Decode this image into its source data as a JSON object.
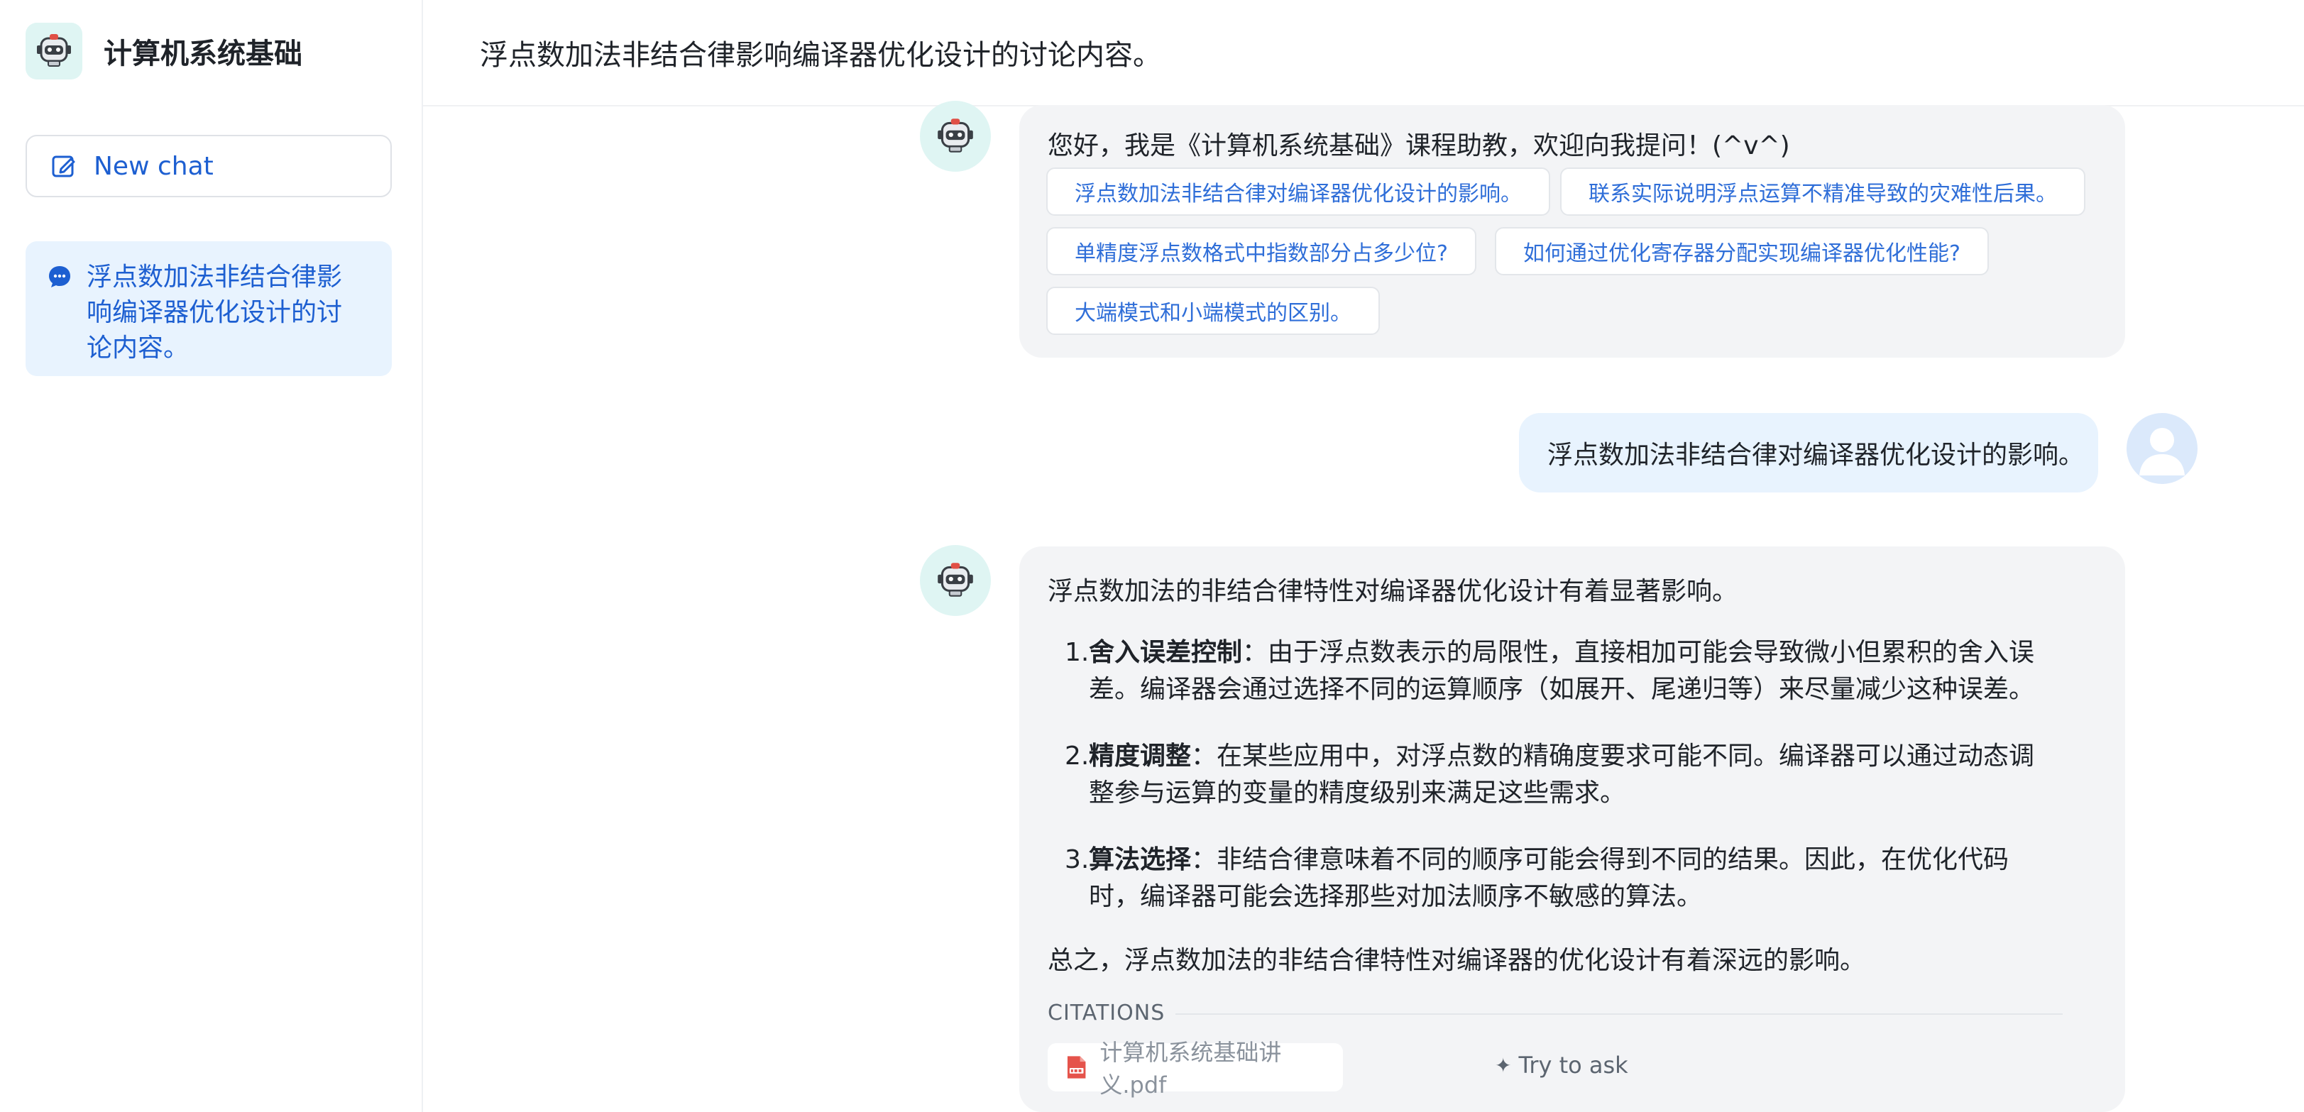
{
  "sidebar": {
    "app_title": "计算机系统基础",
    "new_chat_label": "New chat",
    "conversations": [
      {
        "label": "浮点数加法非结合律影响编译器优化设计的讨论内容。"
      }
    ]
  },
  "header": {
    "title": "浮点数加法非结合律影响编译器优化设计的讨论内容。"
  },
  "chat": {
    "greeting": {
      "text": "您好，我是《计算机系统基础》课程助教，欢迎向我提问！(^v^)",
      "suggestions": [
        "浮点数加法非结合律对编译器优化设计的影响。",
        "联系实际说明浮点运算不精准导致的灾难性后果。",
        "单精度浮点数格式中指数部分占多少位?",
        "如何通过优化寄存器分配实现编译器优化性能?",
        "大端模式和小端模式的区别。"
      ]
    },
    "user_message": "浮点数加法非结合律对编译器优化设计的影响。",
    "answer": {
      "intro": "浮点数加法的非结合律特性对编译器优化设计有着显著影响。",
      "items": [
        {
          "num": "1.",
          "title": "舍入误差控制",
          "text": "：由于浮点数表示的局限性，直接相加可能会导致微小但累积的舍入误差。编译器会通过选择不同的运算顺序（如展开、尾递归等）来尽量减少这种误差。"
        },
        {
          "num": "2.",
          "title": "精度调整",
          "text": "：在某些应用中，对浮点数的精确度要求可能不同。编译器可以通过动态调整参与运算的变量的精度级别来满足这些需求。"
        },
        {
          "num": "3.",
          "title": "算法选择",
          "text": "：非结合律意味着不同的顺序可能会得到不同的结果。因此，在优化代码时，编译器可能会选择那些对加法顺序不敏感的算法。"
        }
      ],
      "summary": "总之，浮点数加法的非结合律特性对编译器的优化设计有着深远的影响。",
      "citations_label": "CITATIONS",
      "citation_file": "计算机系统基础讲义.pdf",
      "try_to_ask": "Try to ask"
    }
  },
  "colors": {
    "accent": "#1d5fd1",
    "selected_bg": "#e8f3fe",
    "bubble_bg": "#f3f4f6",
    "avatar_bg": "#dff5f3"
  },
  "icons": [
    "robot-icon",
    "edit-icon",
    "chat-bubble-icon",
    "user-icon",
    "pdf-icon",
    "sparkle-icon"
  ]
}
